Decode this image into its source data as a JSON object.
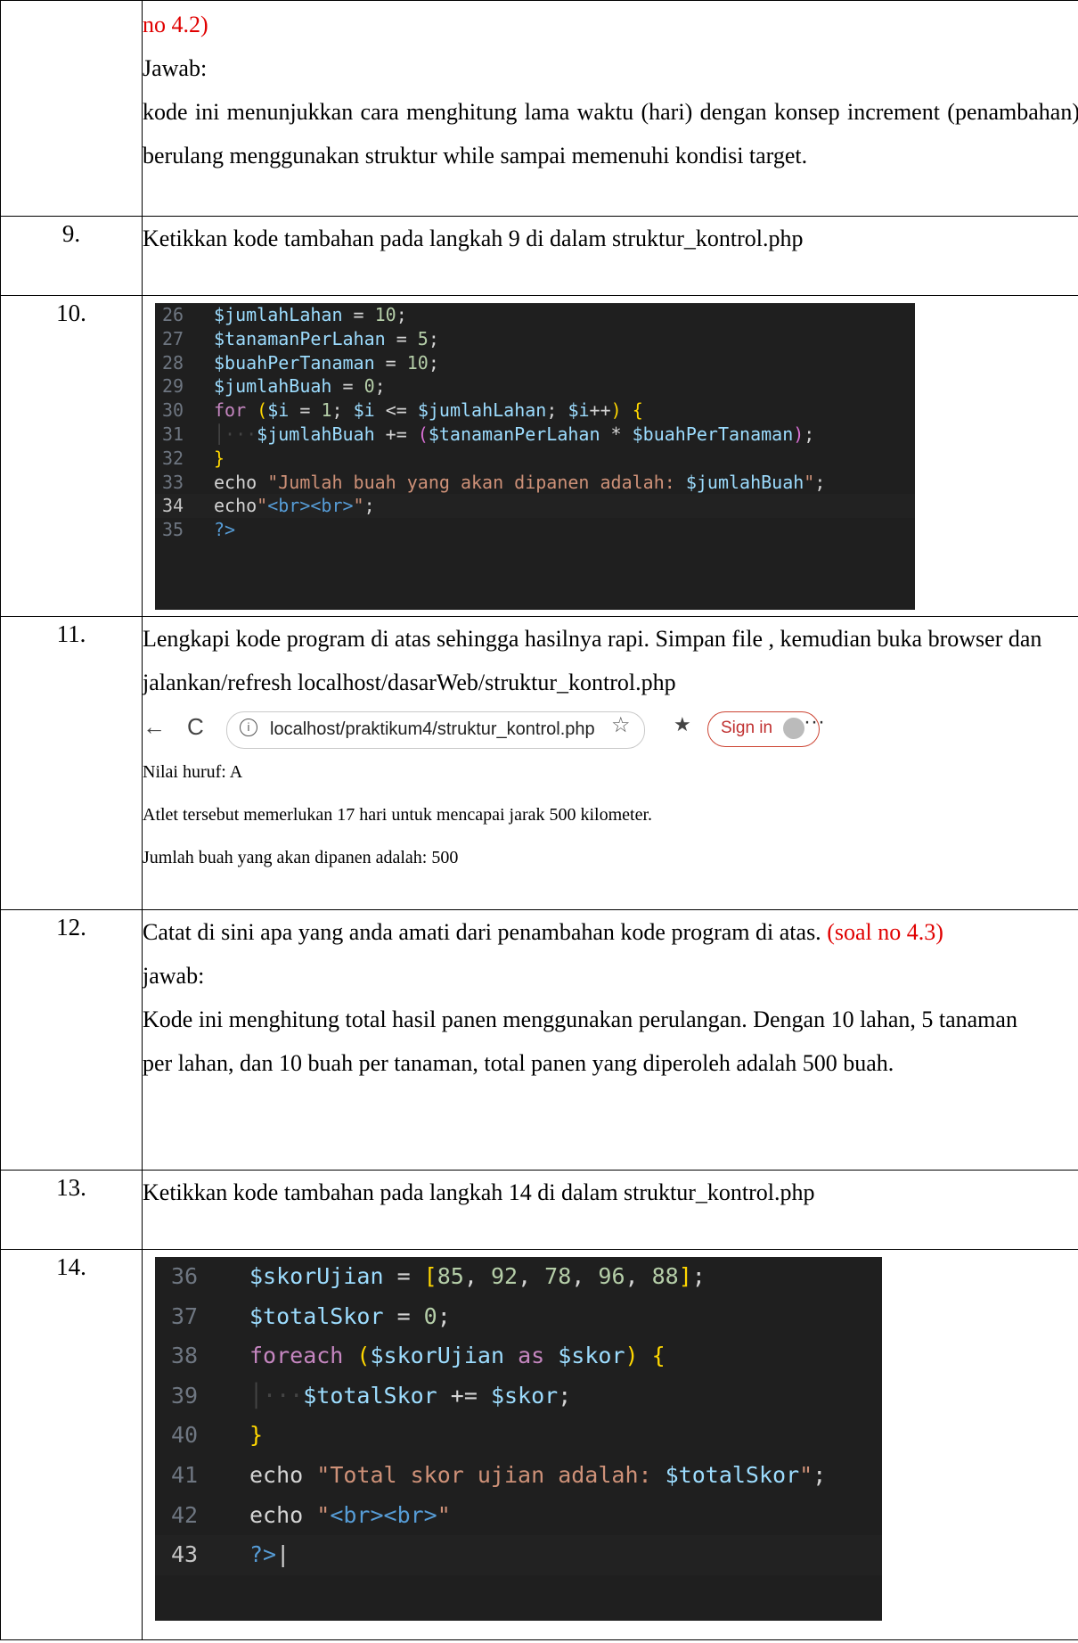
{
  "rows": {
    "r8": {
      "text_red": "no 4.2)",
      "answer_label": "Jawab:",
      "answer": "kode ini menunjukkan cara menghitung lama waktu (hari) dengan konsep increment (penambahan) berulang menggunakan struktur while sampai memenuhi kondisi target."
    },
    "r9": {
      "num": "9.",
      "text": "Ketikkan kode tambahan pada langkah 9 di dalam struktur_kontrol.php"
    },
    "r10": {
      "num": "10."
    },
    "r11": {
      "num": "11.",
      "text": "Lengkapi kode program di atas sehingga hasilnya rapi. Simpan file , kemudian buka browser dan jalankan/refresh localhost/dasarWeb/struktur_kontrol.php"
    },
    "r12": {
      "num": "12.",
      "text": "Catat di sini apa yang anda amati dari penambahan kode program di atas.",
      "text_red": "(soal no 4.3)",
      "answer_label": "jawab:",
      "answer": "Kode ini menghitung total hasil panen menggunakan perulangan. Dengan 10 lahan, 5 tanaman per lahan, dan 10 buah per tanaman, total panen yang diperoleh adalah 500 buah."
    },
    "r13": {
      "num": "13.",
      "text": "Ketikkan kode tambahan pada langkah 14 di dalam struktur_kontrol.php"
    },
    "r14": {
      "num": "14."
    }
  },
  "code1": {
    "lines": [
      {
        "n": "26",
        "segs": [
          [
            "v",
            "$jumlahLahan"
          ],
          [
            "o",
            " = "
          ],
          [
            "n",
            "10"
          ],
          [
            "o",
            ";"
          ]
        ]
      },
      {
        "n": "27",
        "segs": [
          [
            "v",
            "$tanamanPerLahan"
          ],
          [
            "o",
            " = "
          ],
          [
            "n",
            "5"
          ],
          [
            "o",
            ";"
          ]
        ]
      },
      {
        "n": "28",
        "segs": [
          [
            "v",
            "$buahPerTanaman"
          ],
          [
            "o",
            " = "
          ],
          [
            "n",
            "10"
          ],
          [
            "o",
            ";"
          ]
        ]
      },
      {
        "n": "29",
        "segs": [
          [
            "v",
            "$jumlahBuah"
          ],
          [
            "o",
            " = "
          ],
          [
            "n",
            "0"
          ],
          [
            "o",
            ";"
          ]
        ]
      },
      {
        "n": "30",
        "segs": [
          [
            "k",
            "for"
          ],
          [
            "o",
            " "
          ],
          [
            "y",
            "("
          ],
          [
            "v",
            "$i"
          ],
          [
            "o",
            " = "
          ],
          [
            "n",
            "1"
          ],
          [
            "o",
            "; "
          ],
          [
            "v",
            "$i"
          ],
          [
            "o",
            " <= "
          ],
          [
            "v",
            "$jumlahLahan"
          ],
          [
            "o",
            "; "
          ],
          [
            "v",
            "$i"
          ],
          [
            "o",
            "++"
          ],
          [
            "y",
            ")"
          ],
          [
            "o",
            " "
          ],
          [
            "y",
            "{"
          ]
        ]
      },
      {
        "n": "31",
        "segs": [
          [
            "guide",
            "│···"
          ],
          [
            "v",
            "$jumlahBuah"
          ],
          [
            "o",
            " += "
          ],
          [
            "pu",
            "("
          ],
          [
            "v",
            "$tanamanPerLahan"
          ],
          [
            "o",
            " * "
          ],
          [
            "v",
            "$buahPerTanaman"
          ],
          [
            "pu",
            ")"
          ],
          [
            "o",
            ";"
          ]
        ]
      },
      {
        "n": "32",
        "segs": [
          [
            "y",
            "}"
          ]
        ]
      },
      {
        "n": "33",
        "segs": [
          [
            "t",
            "echo "
          ],
          [
            "s",
            "\"Jumlah buah yang akan dipanen adalah: "
          ],
          [
            "v",
            "$jumlahBuah"
          ],
          [
            "s",
            "\""
          ],
          [
            "o",
            ";"
          ]
        ]
      },
      {
        "n": "34",
        "active": true,
        "segs": [
          [
            "t",
            "echo"
          ],
          [
            "s",
            "\""
          ],
          [
            "tag",
            "<br><br>"
          ],
          [
            "s",
            "\""
          ],
          [
            "o",
            ";"
          ]
        ]
      },
      {
        "n": "35",
        "segs": [
          [
            "tag",
            "?>"
          ]
        ]
      }
    ]
  },
  "browser": {
    "back": "←",
    "refresh": "C",
    "info": "i",
    "url": "localhost/praktikum4/struktur_kontrol.php",
    "star": "☆",
    "favorites": "★",
    "signin": "Sign in",
    "more": "···"
  },
  "output": {
    "line1": "Nilai huruf: A",
    "line2": "Atlet tersebut memerlukan 17 hari untuk mencapai jarak 500 kilometer.",
    "line3": "Jumlah buah yang akan dipanen adalah: 500"
  },
  "code2": {
    "lines": [
      {
        "n": "36",
        "segs": [
          [
            "v",
            "$skorUjian"
          ],
          [
            "o",
            " = "
          ],
          [
            "y",
            "["
          ],
          [
            "n",
            "85"
          ],
          [
            "o",
            ", "
          ],
          [
            "n",
            "92"
          ],
          [
            "o",
            ", "
          ],
          [
            "n",
            "78"
          ],
          [
            "o",
            ", "
          ],
          [
            "n",
            "96"
          ],
          [
            "o",
            ", "
          ],
          [
            "n",
            "88"
          ],
          [
            "y",
            "]"
          ],
          [
            "o",
            ";"
          ]
        ]
      },
      {
        "n": "37",
        "segs": [
          [
            "v",
            "$totalSkor"
          ],
          [
            "o",
            " = "
          ],
          [
            "n",
            "0"
          ],
          [
            "o",
            ";"
          ]
        ]
      },
      {
        "n": "38",
        "segs": [
          [
            "k",
            "foreach"
          ],
          [
            "o",
            " "
          ],
          [
            "y",
            "("
          ],
          [
            "v",
            "$skorUjian"
          ],
          [
            "o",
            " "
          ],
          [
            "k",
            "as"
          ],
          [
            "o",
            " "
          ],
          [
            "v",
            "$skor"
          ],
          [
            "y",
            ")"
          ],
          [
            "o",
            " "
          ],
          [
            "y",
            "{"
          ]
        ]
      },
      {
        "n": "39",
        "segs": [
          [
            "guide",
            "│···"
          ],
          [
            "v",
            "$totalSkor"
          ],
          [
            "o",
            " += "
          ],
          [
            "v",
            "$skor"
          ],
          [
            "o",
            ";"
          ]
        ]
      },
      {
        "n": "40",
        "segs": [
          [
            "y",
            "}"
          ]
        ]
      },
      {
        "n": "41",
        "segs": [
          [
            "t",
            "echo "
          ],
          [
            "s",
            "\"Total skor ujian adalah: "
          ],
          [
            "v",
            "$totalSkor"
          ],
          [
            "s",
            "\""
          ],
          [
            "o",
            ";"
          ]
        ]
      },
      {
        "n": "42",
        "segs": [
          [
            "t",
            "echo "
          ],
          [
            "s",
            "\""
          ],
          [
            "tag",
            "<br><br>"
          ],
          [
            "s",
            "\""
          ]
        ]
      },
      {
        "n": "43",
        "active": true,
        "segs": [
          [
            "tag",
            "?>"
          ],
          [
            "o",
            "|"
          ]
        ]
      }
    ]
  }
}
